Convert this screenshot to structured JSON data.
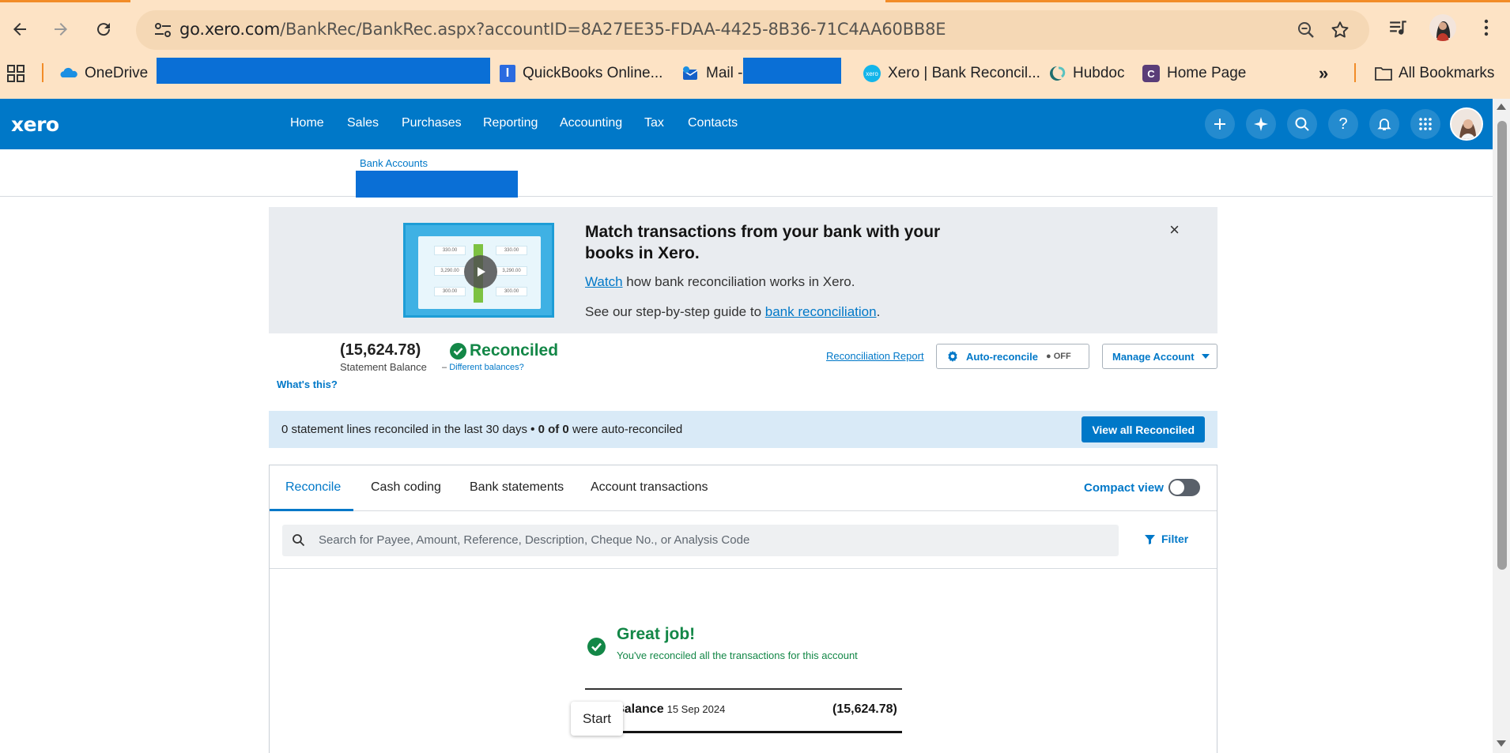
{
  "browser": {
    "url_host": "go.xero.com",
    "url_path": "/BankRec/BankRec.aspx?accountID=8A27EE35-FDAA-4425-8B36-71C4AA60BB8E",
    "bookmarks": [
      {
        "label": "OneDrive",
        "icon": "onedrive-icon"
      },
      {
        "label": "QuickBooks Online...",
        "icon": "quickbooks-icon"
      },
      {
        "label": "Mail -",
        "icon": "mail-icon"
      },
      {
        "label": "Xero | Bank Reconcil...",
        "icon": "xero-icon"
      },
      {
        "label": "Hubdoc",
        "icon": "hubdoc-icon"
      },
      {
        "label": "Home Page",
        "icon": "homepage-icon"
      }
    ],
    "more_bookmarks": "»",
    "all_bookmarks": "All Bookmarks",
    "accent_color": "#f28c28",
    "chrome_color": "#fde3c5"
  },
  "xero": {
    "logo": "xero",
    "nav": [
      "Home",
      "Sales",
      "Purchases",
      "Reporting",
      "Accounting",
      "Tax",
      "Contacts"
    ],
    "brand_color": "#0078c8",
    "breadcrumb": "Bank Accounts"
  },
  "banner": {
    "title": "Match transactions from your bank with your books in Xero.",
    "line1_link": "Watch",
    "line1_rest": " how bank reconciliation works in Xero.",
    "line2_pre": "See our step-by-step guide to ",
    "line2_link": "bank reconciliation",
    "line2_post": ".",
    "close": "×",
    "thumb_values": [
      "330.00",
      "330.00",
      "3,290.00",
      "3,290.00",
      "300.00",
      "300.00"
    ]
  },
  "balance": {
    "amount": "(15,624.78)",
    "label": "Statement Balance",
    "status": "Reconciled",
    "diff_prefix": "– ",
    "diff_link": "Different balances?",
    "whats_this": "What's this?",
    "reconciliation_report": "Reconciliation Report",
    "auto_reconcile": "Auto-reconcile",
    "auto_state": "● OFF",
    "manage_account": "Manage Account",
    "status_color": "#138747"
  },
  "info": {
    "text_a": "0 statement lines reconciled in the last 30 days",
    "text_b": " • 0 of 0 ",
    "text_c": " were auto-reconciled",
    "button": "View all Reconciled"
  },
  "tabs": {
    "items": [
      "Reconcile",
      "Cash coding",
      "Bank statements",
      "Account transactions"
    ],
    "active": "Reconcile",
    "compact_view": "Compact view",
    "compact_on": false
  },
  "search": {
    "placeholder": "Search for Payee, Amount, Reference, Description, Cheque No., or Analysis Code",
    "filter": "Filter"
  },
  "done": {
    "title": "Great job!",
    "subtitle": "You've reconciled all the transactions for this account",
    "summary_label": "nent Balance",
    "summary_date": "15 Sep 2024",
    "summary_amount": "(15,624.78)"
  },
  "tooltip": {
    "start": "Start"
  }
}
